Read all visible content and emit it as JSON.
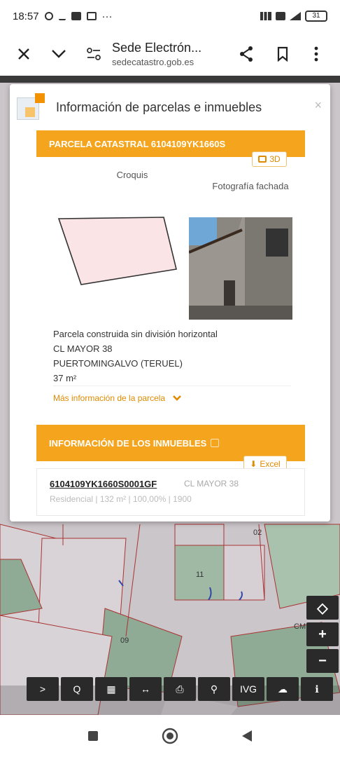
{
  "status_bar": {
    "time": "18:57",
    "extra": "···",
    "battery": "31"
  },
  "browser": {
    "title": "Sede Electrón...",
    "url": "sedecatastro.gob.es"
  },
  "modal": {
    "title": "Información de parcelas e inmuebles",
    "close": "×",
    "parcel_header": "PARCELA CATASTRAL 6104109YK1660S",
    "btn_3d": "3D",
    "croquis_label": "Croquis",
    "foto_label": "Fotografía fachada",
    "info": {
      "line1": "Parcela construida sin división horizontal",
      "line2": "CL MAYOR 38",
      "line3": "PUERTOMINGALVO (TERUEL)",
      "line4": "37 m²"
    },
    "more_link": "Más información de la parcela",
    "inmuebles_header": "INFORMACIÓN DE LOS INMUEBLES",
    "excel_btn": "Excel",
    "inmueble": {
      "ref": "6104109YK1660S0001GF",
      "address": "CL MAYOR 38",
      "detail": "Residencial | 132 m² | 100,00% | 1900"
    }
  },
  "map": {
    "labels": [
      "02",
      "11",
      "09",
      "CM"
    ]
  },
  "toolbar": {
    "items": [
      ">",
      "Q",
      "▦",
      "↔",
      "⎙",
      "⚲",
      "IVG",
      "☁",
      "ℹ"
    ]
  },
  "zoom": {
    "locate": "◇",
    "plus": "+",
    "minus": "−"
  }
}
